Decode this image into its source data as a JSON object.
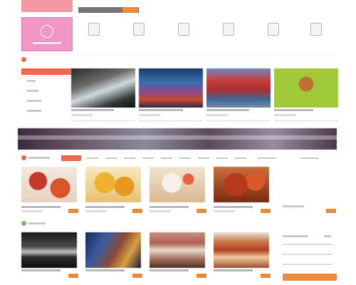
{
  "colors": {
    "accent": "#f06a50",
    "orange": "#f08a3c",
    "pink": "#f098c8"
  },
  "services": [
    {
      "icon": "document-icon",
      "label": ""
    },
    {
      "icon": "calendar-icon",
      "label": ""
    },
    {
      "icon": "list-icon",
      "label": ""
    },
    {
      "icon": "chat-icon",
      "label": ""
    },
    {
      "icon": "star-icon",
      "label": ""
    },
    {
      "icon": "tool-icon",
      "label": ""
    }
  ],
  "sections": {
    "first_title": "",
    "food_title": "",
    "third_title": ""
  },
  "sidebar": {
    "items": [
      "",
      "",
      "",
      ""
    ]
  },
  "row1": [
    {
      "title": "",
      "meta": ""
    },
    {
      "title": "",
      "meta": ""
    },
    {
      "title": "",
      "meta": ""
    },
    {
      "title": "",
      "meta": ""
    }
  ],
  "tabs": [
    "",
    "",
    "",
    "",
    "",
    "",
    "",
    "",
    "",
    "",
    "",
    ""
  ],
  "food": [
    {
      "title": "",
      "price": ""
    },
    {
      "title": "",
      "price": ""
    },
    {
      "title": "",
      "price": ""
    },
    {
      "title": "",
      "price": ""
    }
  ],
  "row3": [
    {
      "title": ""
    },
    {
      "title": ""
    },
    {
      "title": ""
    },
    {
      "title": ""
    }
  ]
}
